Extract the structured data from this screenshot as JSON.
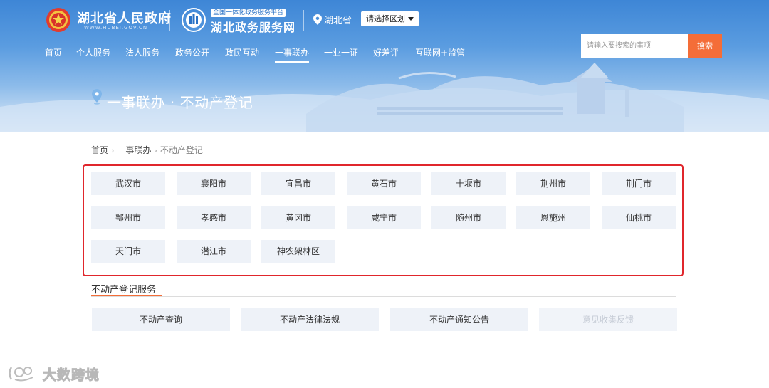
{
  "header": {
    "site_title": "湖北省人民政府",
    "site_subtitle": "WWW.HUBEI.GOV.CN",
    "platform_badge": "全国一体化政务服务平台",
    "platform_name": "湖北政务服务网",
    "province": "湖北省",
    "region_select": "请选择区划",
    "search": {
      "placeholder": "请输入要搜索的事项",
      "button": "搜索"
    },
    "nav": [
      "首页",
      "个人服务",
      "法人服务",
      "政务公开",
      "政民互动",
      "一事联办",
      "一业一证",
      "好差评",
      "互联网+监管"
    ],
    "active_nav": "一事联办"
  },
  "page": {
    "title": "一事联办 · 不动产登记"
  },
  "breadcrumb": [
    "首页",
    "一事联办",
    "不动产登记"
  ],
  "cities": [
    "武汉市",
    "襄阳市",
    "宜昌市",
    "黄石市",
    "十堰市",
    "荆州市",
    "荆门市",
    "鄂州市",
    "孝感市",
    "黄冈市",
    "咸宁市",
    "随州市",
    "恩施州",
    "仙桃市",
    "天门市",
    "潜江市",
    "神农架林区"
  ],
  "services": {
    "title": "不动产登记服务",
    "items": [
      {
        "label": "不动产查询",
        "disabled": false
      },
      {
        "label": "不动产法律法规",
        "disabled": false
      },
      {
        "label": "不动产通知公告",
        "disabled": false
      },
      {
        "label": "意见收集反馈",
        "disabled": true
      }
    ]
  },
  "watermark": {
    "text": "大数跨境"
  },
  "colors": {
    "header_blue": "#3e86d6",
    "accent_orange": "#f46d38",
    "highlight_red": "#e0262c",
    "button_bg": "#eef2f8"
  }
}
